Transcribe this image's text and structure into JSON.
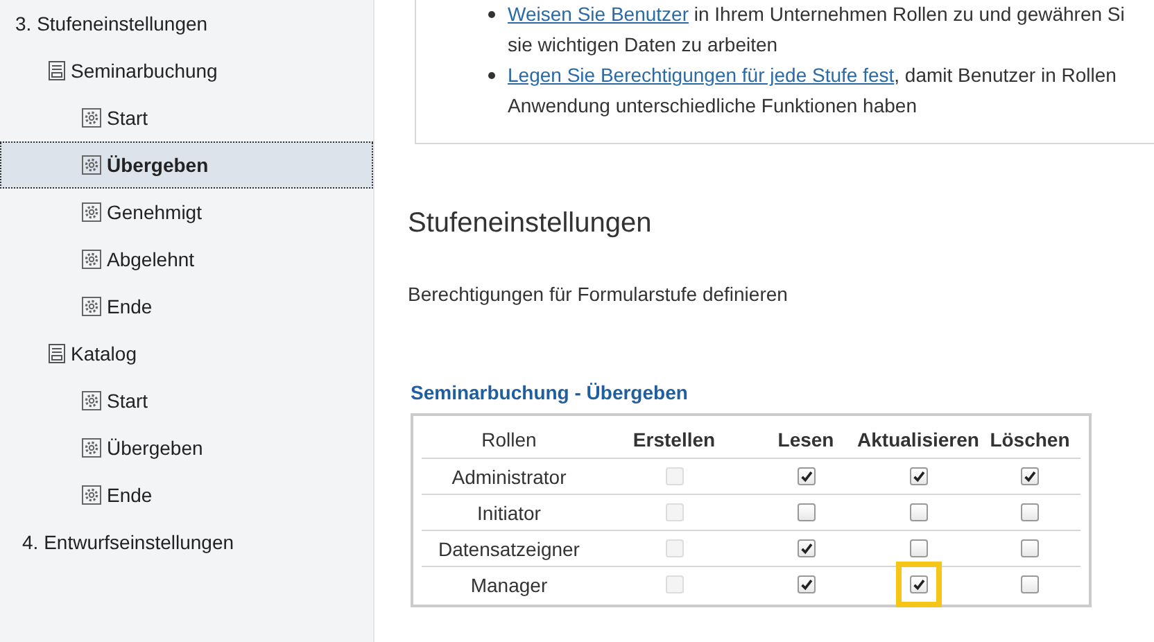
{
  "sidebar": {
    "items": [
      {
        "label": "3. Stufeneinstellungen",
        "kind": "section",
        "selected": false,
        "children": [
          {
            "label": "Seminarbuchung",
            "kind": "form",
            "selected": false,
            "children": [
              {
                "label": "Start",
                "kind": "stage",
                "selected": false
              },
              {
                "label": "Übergeben",
                "kind": "stage",
                "selected": true
              },
              {
                "label": "Genehmigt",
                "kind": "stage",
                "selected": false
              },
              {
                "label": "Abgelehnt",
                "kind": "stage",
                "selected": false
              },
              {
                "label": "Ende",
                "kind": "stage",
                "selected": false
              }
            ]
          },
          {
            "label": "Katalog",
            "kind": "form",
            "selected": false,
            "children": [
              {
                "label": "Start",
                "kind": "stage",
                "selected": false
              },
              {
                "label": "Übergeben",
                "kind": "stage",
                "selected": false
              },
              {
                "label": "Ende",
                "kind": "stage",
                "selected": false
              }
            ]
          }
        ]
      },
      {
        "label": "4. Entwurfseinstellungen",
        "kind": "section",
        "selected": false
      }
    ]
  },
  "intro": {
    "bullets": [
      {
        "link": "Weisen Sie Benutzer",
        "text": " in Ihrem Unternehmen Rollen zu und gewähren Si\nsie wichtigen Daten zu arbeiten"
      },
      {
        "link": "Legen Sie Berechtigungen für jede Stufe fest",
        "text": ", damit Benutzer in Rollen\nAnwendung unterschiedliche Funktionen haben"
      }
    ]
  },
  "section": {
    "title": "Stufeneinstellungen",
    "description": "Berechtigungen für Formularstufe definieren"
  },
  "table": {
    "title": "Seminarbuchung - Übergeben",
    "columns": [
      "Rollen",
      "Erstellen",
      "Lesen",
      "Aktualisieren",
      "Löschen"
    ],
    "rows": [
      {
        "role": "Administrator",
        "cells": [
          {
            "checked": false,
            "disabled": true,
            "highlighted": false
          },
          {
            "checked": true,
            "disabled": false,
            "highlighted": false
          },
          {
            "checked": true,
            "disabled": false,
            "highlighted": false
          },
          {
            "checked": true,
            "disabled": false,
            "highlighted": false
          }
        ]
      },
      {
        "role": "Initiator",
        "cells": [
          {
            "checked": false,
            "disabled": true,
            "highlighted": false
          },
          {
            "checked": false,
            "disabled": false,
            "highlighted": false
          },
          {
            "checked": false,
            "disabled": false,
            "highlighted": false
          },
          {
            "checked": false,
            "disabled": false,
            "highlighted": false
          }
        ]
      },
      {
        "role": "Datensatzeigner",
        "cells": [
          {
            "checked": false,
            "disabled": true,
            "highlighted": false
          },
          {
            "checked": true,
            "disabled": false,
            "highlighted": false
          },
          {
            "checked": false,
            "disabled": false,
            "highlighted": false
          },
          {
            "checked": false,
            "disabled": false,
            "highlighted": false
          }
        ]
      },
      {
        "role": "Manager",
        "cells": [
          {
            "checked": false,
            "disabled": true,
            "highlighted": false
          },
          {
            "checked": true,
            "disabled": false,
            "highlighted": false
          },
          {
            "checked": true,
            "disabled": false,
            "highlighted": true
          },
          {
            "checked": false,
            "disabled": false,
            "highlighted": false
          }
        ]
      }
    ]
  }
}
